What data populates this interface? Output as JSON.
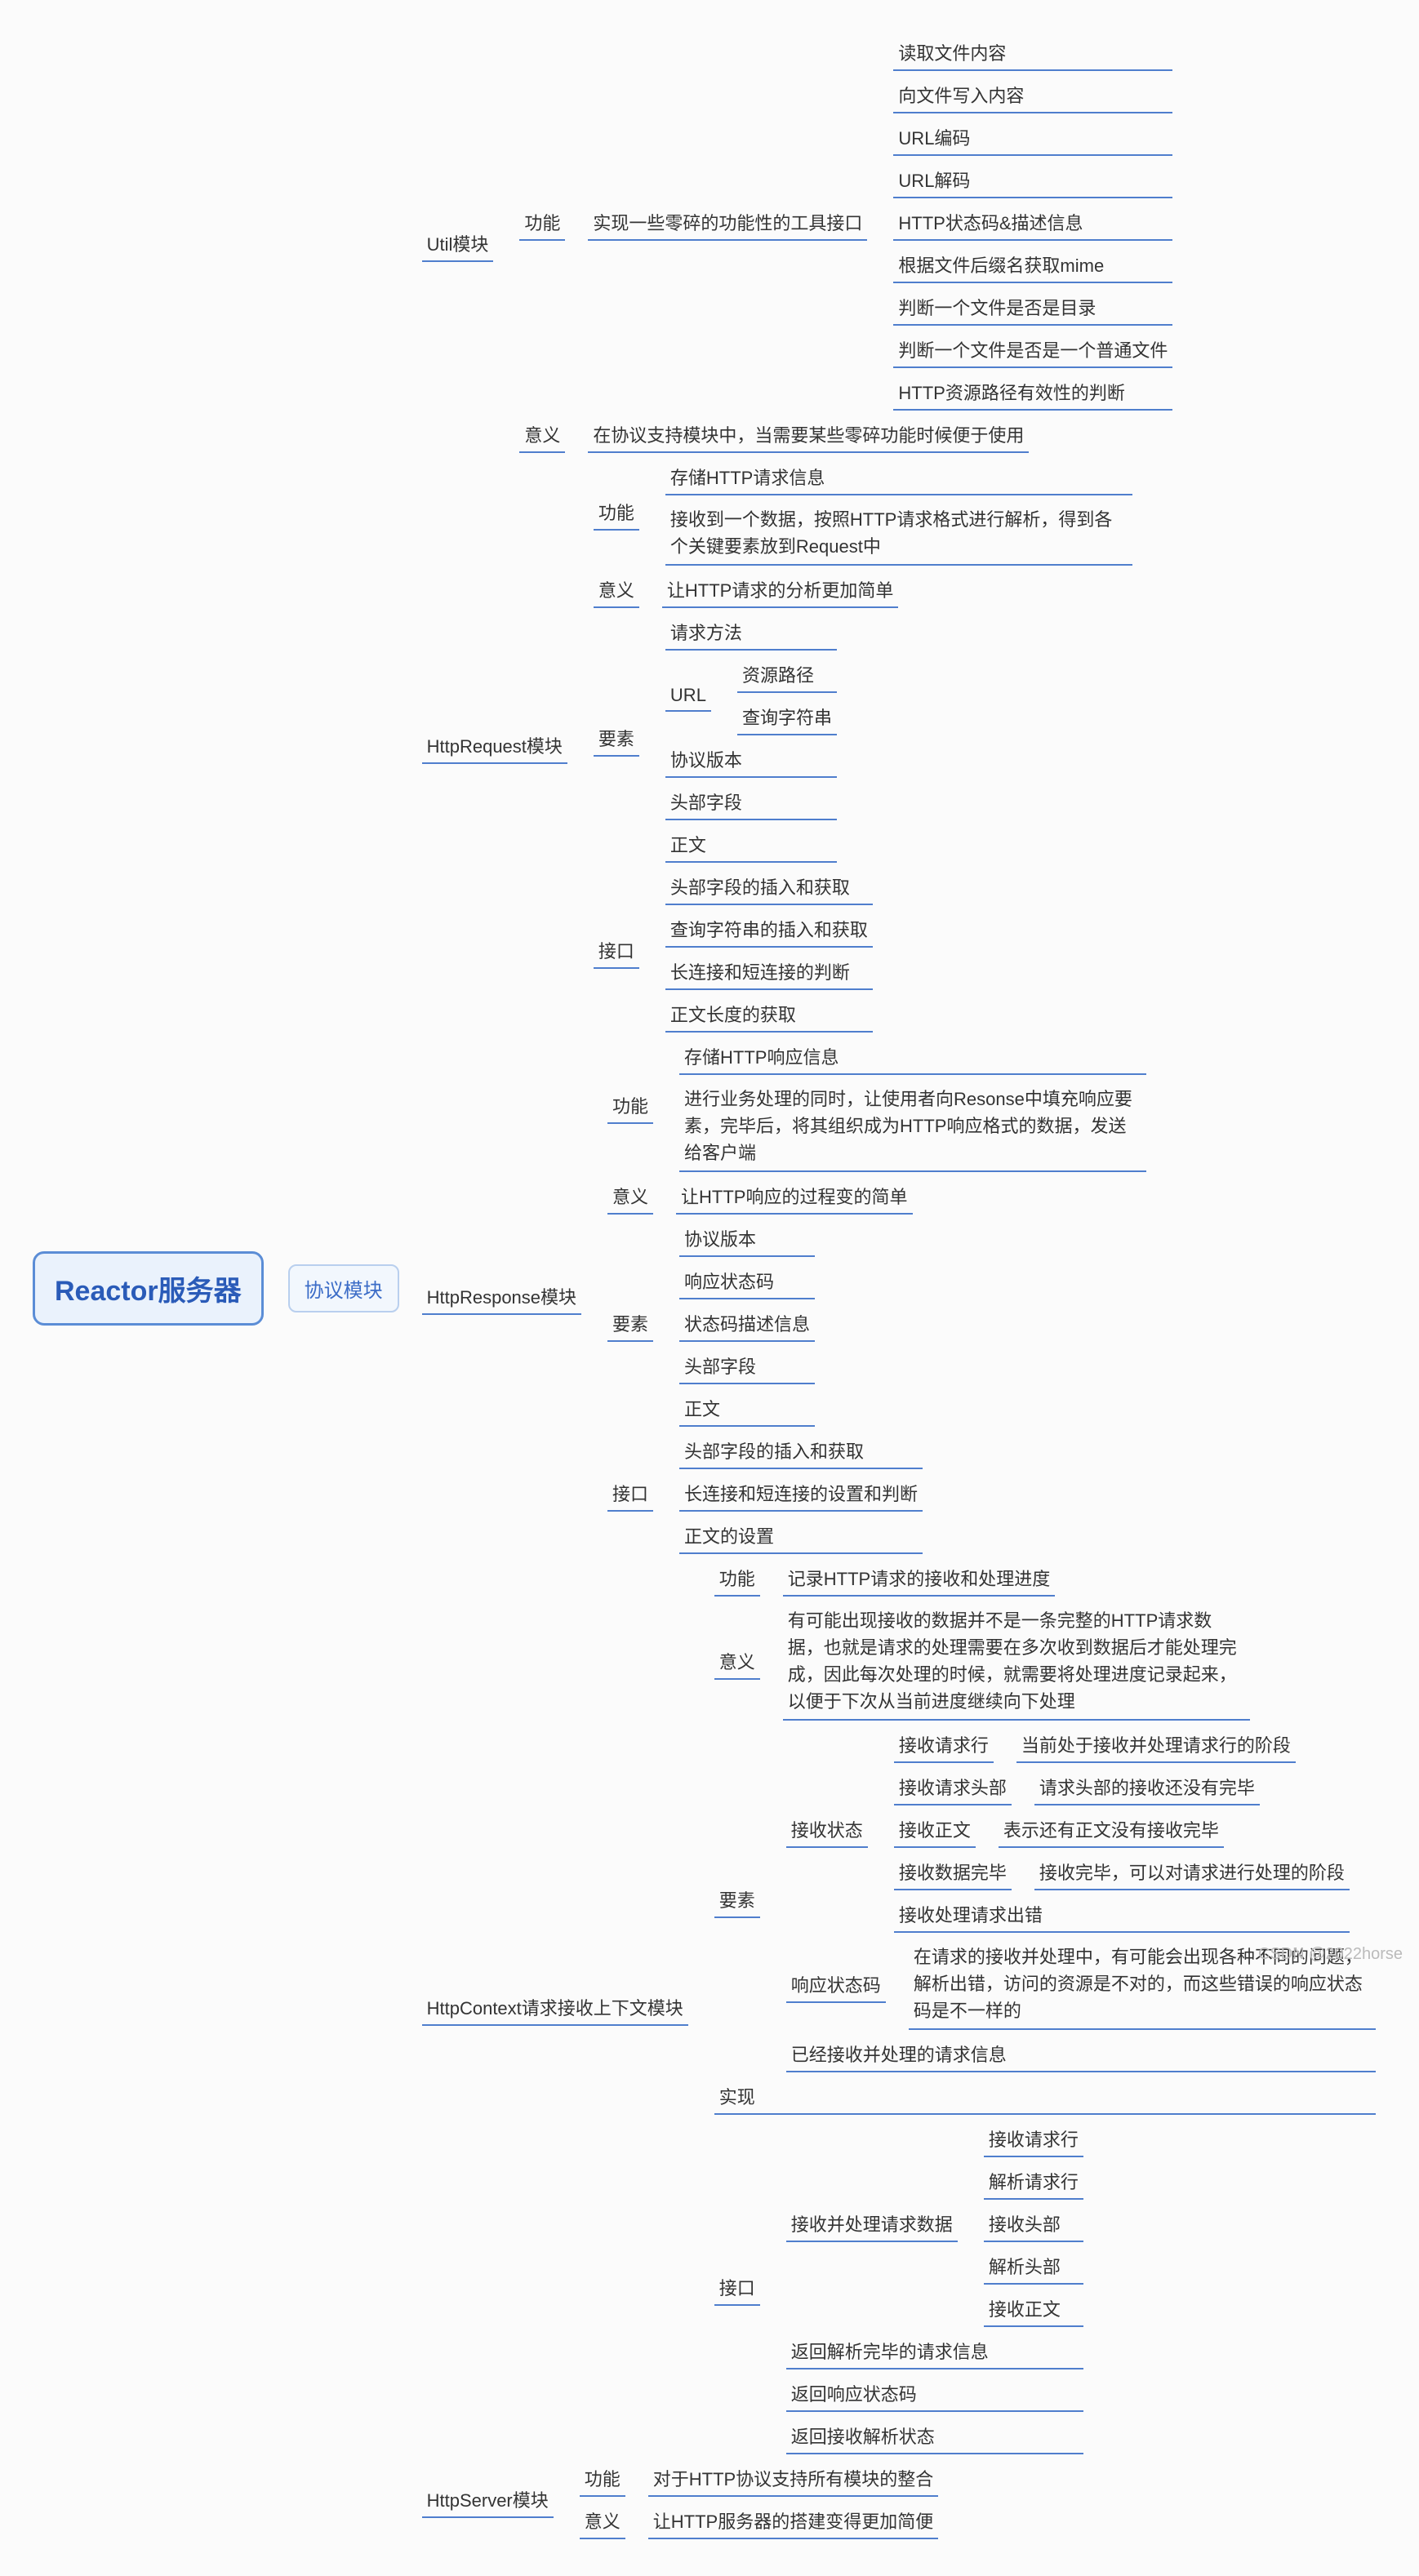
{
  "watermark": "CSDN @2022horse",
  "root": "Reactor服务器",
  "protocol": "协议模块",
  "modules": {
    "util": {
      "title": "Util模块",
      "funLabel": "功能",
      "funDesc": "实现一些零碎的功能性的工具接口",
      "funItems": [
        "读取文件内容",
        "向文件写入内容",
        "URL编码",
        "URL解码",
        "HTTP状态码&描述信息",
        "根据文件后缀名获取mime",
        "判断一个文件是否是目录",
        "判断一个文件是否是一个普通文件",
        "HTTP资源路径有效性的判断"
      ],
      "sigLabel": "意义",
      "sigDesc": "在协议支持模块中，当需要某些零碎功能时候便于使用"
    },
    "req": {
      "title": "HttpRequest模块",
      "funLabel": "功能",
      "funItems": [
        "存储HTTP请求信息",
        "接收到一个数据，按照HTTP请求格式进行解析，得到各个关键要素放到Request中"
      ],
      "sigLabel": "意义",
      "sigDesc": "让HTTP请求的分析更加简单",
      "elemLabel": "要素",
      "elem": {
        "method": "请求方法",
        "url": "URL",
        "urlPath": "资源路径",
        "urlQuery": "查询字符串",
        "version": "协议版本",
        "header": "头部字段",
        "body": "正文"
      },
      "ifLabel": "接口",
      "ifItems": [
        "头部字段的插入和获取",
        "查询字符串的插入和获取",
        "长连接和短连接的判断",
        "正文长度的获取"
      ]
    },
    "res": {
      "title": "HttpResponse模块",
      "funLabel": "功能",
      "funItems": [
        "存储HTTP响应信息",
        "进行业务处理的同时，让使用者向Resonse中填充响应要素，完毕后，将其组织成为HTTP响应格式的数据，发送给客户端"
      ],
      "sigLabel": "意义",
      "sigDesc": "让HTTP响应的过程变的简单",
      "elemLabel": "要素",
      "elemItems": [
        "协议版本",
        "响应状态码",
        "状态码描述信息",
        "头部字段",
        "正文"
      ],
      "ifLabel": "接口",
      "ifItems": [
        "头部字段的插入和获取",
        "长连接和短连接的设置和判断",
        "正文的设置"
      ]
    },
    "ctx": {
      "title": "HttpContext请求接收上下文模块",
      "funLabel": "功能",
      "funDesc": "记录HTTP请求的接收和处理进度",
      "sigLabel": "意义",
      "sigDesc": "有可能出现接收的数据并不是一条完整的HTTP请求数据，也就是请求的处理需要在多次收到数据后才能处理完成，因此每次处理的时候，就需要将处理进度记录起来，以便于下次从当前进度继续向下处理",
      "elemLabel": "要素",
      "recv": {
        "label": "接收状态",
        "r1": {
          "t": "接收请求行",
          "d": "当前处于接收并处理请求行的阶段"
        },
        "r2": {
          "t": "接收请求头部",
          "d": "请求头部的接收还没有完毕"
        },
        "r3": {
          "t": "接收正文",
          "d": "表示还有正文没有接收完毕"
        },
        "r4": {
          "t": "接收数据完毕",
          "d": "接收完毕，可以对请求进行处理的阶段"
        },
        "r5": {
          "t": "接收处理请求出错"
        }
      },
      "status": {
        "t": "响应状态码",
        "d": "在请求的接收并处理中，有可能会出现各种不同的问题，解析出错，访问的资源是不对的，而这些错误的响应状态码是不一样的"
      },
      "processed": "已经接收并处理的请求信息",
      "implLabel": "实现",
      "ifLabel": "接口",
      "proc": {
        "t": "接收并处理请求数据",
        "items": [
          "接收请求行",
          "解析请求行",
          "接收头部",
          "解析头部",
          "接收正文"
        ]
      },
      "ifItems": [
        "返回解析完毕的请求信息",
        "返回响应状态码",
        "返回接收解析状态"
      ]
    },
    "srv": {
      "title": "HttpServer模块",
      "funLabel": "功能",
      "funDesc": "对于HTTP协议支持所有模块的整合",
      "sigLabel": "意义",
      "sigDesc": "让HTTP服务器的搭建变得更加简便"
    }
  }
}
